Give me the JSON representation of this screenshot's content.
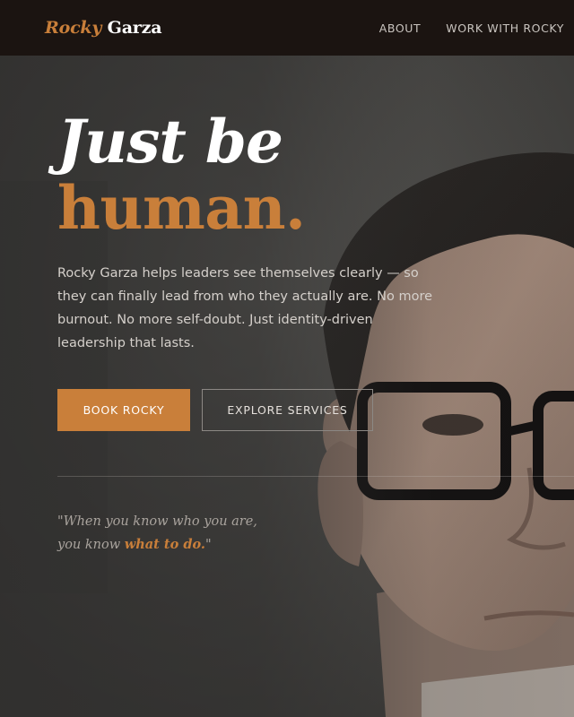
{
  "header": {
    "logo_first": "Rocky",
    "logo_last": "Garza",
    "nav": [
      "ABOUT",
      "WORK WITH ROCKY"
    ]
  },
  "hero": {
    "headline_line1": "Just be",
    "headline_line2": "human.",
    "intro": "Rocky Garza helps leaders see themselves clearly — so they can finally lead from who they actually are. No more burnout. No more self-doubt. Just identity-driven leadership that lasts.",
    "primary_button": "BOOK ROCKY",
    "secondary_button": "EXPLORE SERVICES",
    "quote_line1": "\"When you know who you are,",
    "quote_line2_prefix": "you know ",
    "quote_line2_accent": "what to do.",
    "quote_line2_suffix": "\""
  },
  "colors": {
    "accent": "#c97f3a",
    "nav_background": "#1b1411",
    "text_light": "#d5d0cb"
  },
  "icons": []
}
